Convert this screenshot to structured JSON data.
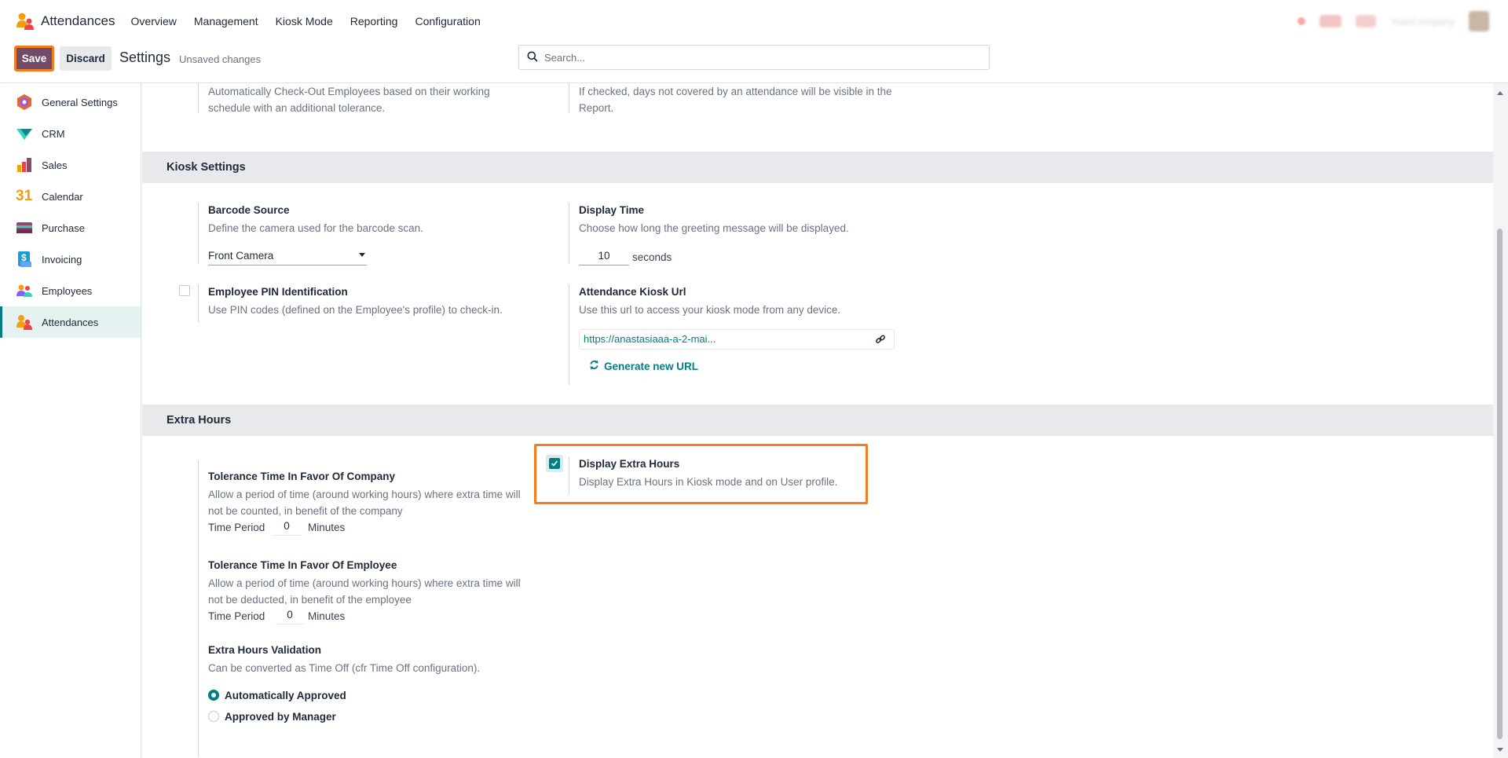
{
  "topnav": {
    "app_name": "Attendances",
    "menu": [
      "Overview",
      "Management",
      "Kiosk Mode",
      "Reporting",
      "Configuration"
    ],
    "company_name": "YourCompany"
  },
  "controlbar": {
    "save_label": "Save",
    "discard_label": "Discard",
    "breadcrumb": "Settings",
    "status": "Unsaved changes",
    "search_placeholder": "Search..."
  },
  "sidebar": {
    "items": [
      {
        "label": "General Settings",
        "icon": "general-settings-icon"
      },
      {
        "label": "CRM",
        "icon": "crm-icon"
      },
      {
        "label": "Sales",
        "icon": "sales-icon"
      },
      {
        "label": "Calendar",
        "icon": "calendar-icon"
      },
      {
        "label": "Purchase",
        "icon": "purchase-icon"
      },
      {
        "label": "Invoicing",
        "icon": "invoicing-icon"
      },
      {
        "label": "Employees",
        "icon": "employees-icon"
      },
      {
        "label": "Attendances",
        "icon": "attendances-icon",
        "active": true
      }
    ],
    "calendar_glyph": "31",
    "invoicing_glyph": "$"
  },
  "top_partial": {
    "left_desc": "Automatically Check-Out Employees based on their working schedule with an additional tolerance.",
    "right_desc": "If checked, days not covered by an attendance will be visible in the Report."
  },
  "kiosk": {
    "header": "Kiosk Settings",
    "barcode_title": "Barcode Source",
    "barcode_desc": "Define the camera used for the barcode scan.",
    "barcode_value": "Front Camera",
    "display_time_title": "Display Time",
    "display_time_desc": "Choose how long the greeting message will be displayed.",
    "display_time_value": "10",
    "display_time_unit": "seconds",
    "pin_title": "Employee PIN Identification",
    "pin_desc": "Use PIN codes (defined on the Employee's profile) to check-in.",
    "pin_checked": false,
    "url_title": "Attendance Kiosk Url",
    "url_desc": "Use this url to access your kiosk mode from any device.",
    "url_value": "https://anastasiaaa-a-2-mai...",
    "generate_label": "Generate new URL"
  },
  "extra_hours": {
    "header": "Extra Hours",
    "display_title": "Display Extra Hours",
    "display_desc": "Display Extra Hours in Kiosk mode and on User profile.",
    "display_checked": true,
    "tol_company_title": "Tolerance Time In Favor Of Company",
    "tol_company_desc": "Allow a period of time (around working hours) where extra time will not be counted, in benefit of the company",
    "tol_company_label": "Time Period",
    "tol_company_value": "0",
    "tol_company_unit": "Minutes",
    "tol_employee_title": "Tolerance Time In Favor Of Employee",
    "tol_employee_desc": "Allow a period of time (around working hours) where extra time will not be deducted, in benefit of the employee",
    "tol_employee_label": "Time Period",
    "tol_employee_value": "0",
    "tol_employee_unit": "Minutes",
    "validation_title": "Extra Hours Validation",
    "validation_desc": "Can be converted as Time Off (cfr Time Off configuration).",
    "validation_options": [
      "Automatically Approved",
      "Approved by Manager"
    ],
    "validation_selected": 0
  },
  "colors": {
    "brand": "#714b67",
    "accent": "#017e84",
    "highlight": "#f57c1f"
  }
}
